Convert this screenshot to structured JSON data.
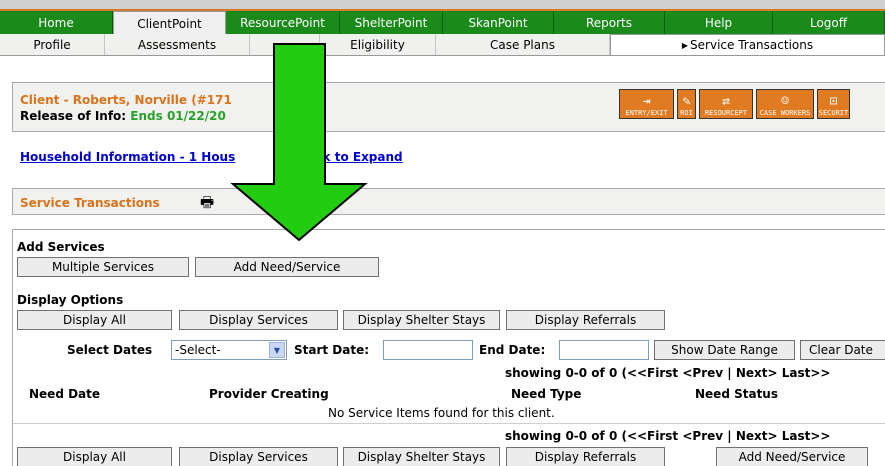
{
  "topnav": {
    "tabs": [
      {
        "label": "Home",
        "active": false
      },
      {
        "label": "ClientPoint",
        "active": true
      },
      {
        "label": "ResourcePoint",
        "active": false
      },
      {
        "label": "ShelterPoint",
        "active": false
      },
      {
        "label": "SkanPoint",
        "active": false
      },
      {
        "label": "Reports",
        "active": false
      },
      {
        "label": "Help",
        "active": false
      },
      {
        "label": "Logoff",
        "active": false
      }
    ]
  },
  "subtabs": [
    {
      "label": "Profile",
      "active": false
    },
    {
      "label": "Assessments",
      "active": false
    },
    {
      "label": "",
      "active": false
    },
    {
      "label": "Eligibility",
      "active": false
    },
    {
      "label": "Case Plans",
      "active": false
    },
    {
      "label": "Service Transactions",
      "active": true
    }
  ],
  "client": {
    "name": "Client - Roberts, Norville (#171",
    "roi_label": "Release of Info:",
    "roi_value": "Ends 01/22/20"
  },
  "toolbar_icons": [
    {
      "label": "ENTRY/EXIT",
      "icon": "entry-exit-icon"
    },
    {
      "label": "ROI",
      "icon": "roi-icon"
    },
    {
      "label": "RESOURCEPT",
      "icon": "resourcepoint-icon"
    },
    {
      "label": "CASE WORKERS",
      "icon": "case-workers-icon"
    },
    {
      "label": "SECURIT",
      "icon": "security-icon"
    }
  ],
  "household_link": "Household Information - 1 Hous",
  "household_link_tail": "- Click to Expand",
  "service_transactions_title": "Service Transactions",
  "add_services": {
    "label": "Add Services",
    "multiple_services": "Multiple Services",
    "add_need_service": "Add Need/Service"
  },
  "display_options": {
    "label": "Display Options",
    "display_all": "Display All",
    "display_services": "Display Services",
    "display_shelter_stays": "Display Shelter Stays",
    "display_referrals": "Display Referrals"
  },
  "dates": {
    "select_dates_label": "Select Dates",
    "select_value": "-Select-",
    "start_date_label": "Start Date:",
    "end_date_label": "End Date:",
    "show_date_range": "Show Date Range",
    "clear_dates": "Clear Date"
  },
  "pager_text": "showing 0-0 of 0 (<<First  <Prev | Next>  Last>>",
  "columns": [
    "Need Date",
    "Provider Creating",
    "Need Type",
    "Need Status"
  ],
  "empty_message": "No Service Items found for this client.",
  "bottom": {
    "display_all": "Display All",
    "display_services": "Display Services",
    "display_shelter_stays": "Display Shelter Stays",
    "display_referrals": "Display Referrals",
    "add_need_service": "Add Need/Service"
  },
  "colors": {
    "nav_green": "#1a8a1a",
    "orange_accent": "#d9731c",
    "link_blue": "#0000cc",
    "arrow_green": "#22cc11"
  }
}
